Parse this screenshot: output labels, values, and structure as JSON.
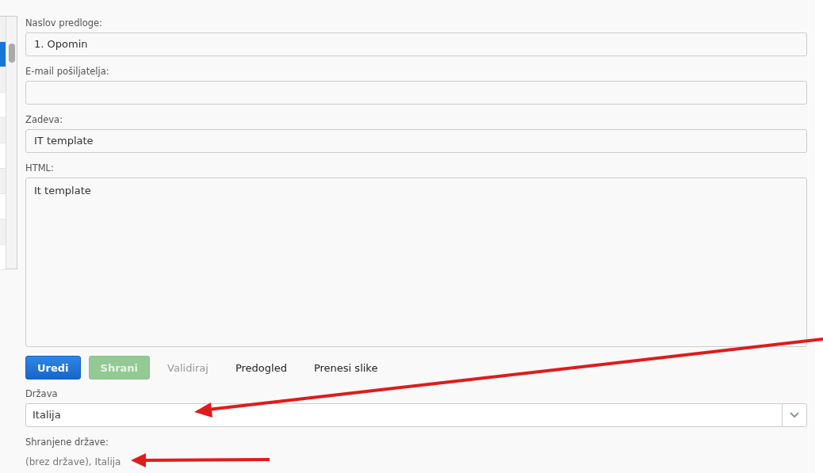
{
  "left_table": {
    "rows": [
      {
        "selected": false
      },
      {
        "selected": true
      },
      {
        "selected": false
      },
      {
        "selected": false
      },
      {
        "selected": false
      },
      {
        "selected": false
      },
      {
        "selected": false
      },
      {
        "selected": false
      },
      {
        "selected": false
      },
      {
        "selected": false
      }
    ]
  },
  "editor": {
    "fields": [
      {
        "label": "Naslov predloge:",
        "value": "1. Opomin"
      },
      {
        "label": "E-mail pošiljatelja:"
      },
      {
        "label": "Zadeva:",
        "value": "IT template"
      }
    ],
    "html": {
      "label": "HTML:",
      "value": "It template"
    },
    "buttons": [
      {
        "label": "Uredi",
        "kind": "primary",
        "disabled": false
      },
      {
        "label": "Shrani",
        "kind": "success",
        "disabled": true
      },
      {
        "label": "Validiraj",
        "kind": "link",
        "disabled": true
      },
      {
        "label": "Predogled",
        "kind": "link",
        "disabled": false
      },
      {
        "label": "Prenesi slike",
        "kind": "link",
        "disabled": false
      }
    ],
    "country": {
      "label": "Država",
      "value": "Italija"
    },
    "saved": {
      "label": "Shranjene države:",
      "value": "(brez države), Italija"
    }
  }
}
